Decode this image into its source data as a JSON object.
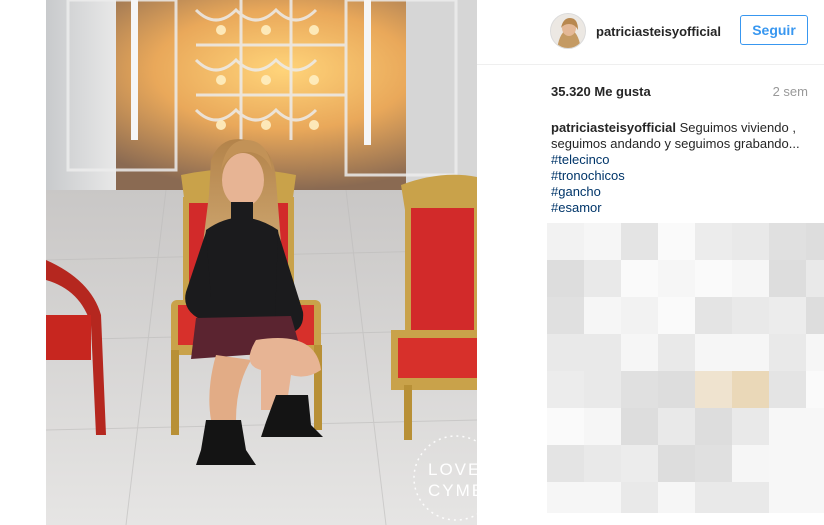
{
  "post": {
    "username": "patriciasteisyofficial",
    "follow_label": "Seguir",
    "likes": "35.320 Me gusta",
    "time_ago": "2 sem",
    "caption": {
      "username": "patriciasteisyofficial",
      "text": " Seguimos viviendo , seguimos andando y seguimos grabando...",
      "hashtags": [
        "#telecinco",
        "#tronochicos",
        "#gancho",
        "#esamor"
      ]
    }
  },
  "photo": {
    "watermark_line1": "LOVE",
    "watermark_line2": "CYMERA"
  },
  "colors": {
    "follow_blue": "#3897f0",
    "hashtag_blue": "#003569",
    "text_dark": "#262626",
    "text_gray": "#999999"
  }
}
